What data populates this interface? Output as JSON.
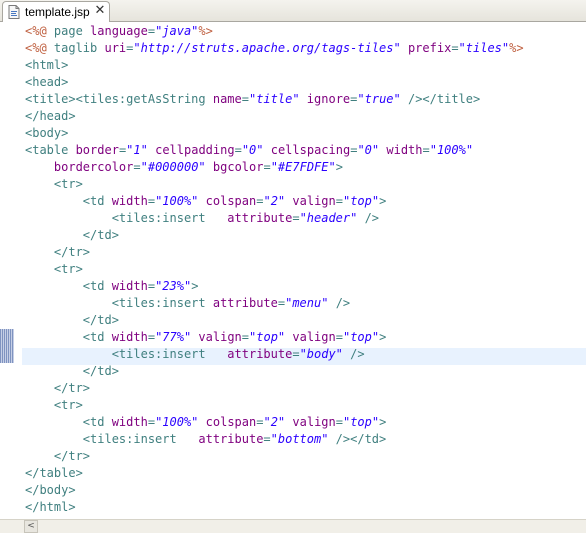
{
  "tab": {
    "label": "template.jsp",
    "close_glyph": "✕",
    "icon": "jsp-file-icon"
  },
  "colors": {
    "directive": "#bf5f3f",
    "tag": "#3f7f7f",
    "attribute": "#7f007f",
    "value": "#2a00ff",
    "current_line": "#e8f2fe"
  },
  "code_lines": [
    [
      [
        "dir",
        "<%@ "
      ],
      [
        "tag",
        "page "
      ],
      [
        "attr",
        "language"
      ],
      [
        "tag",
        "="
      ],
      [
        "val",
        "\"java\""
      ],
      [
        "dir",
        "%>"
      ]
    ],
    [
      [
        "dir",
        "<%@ "
      ],
      [
        "tag",
        "taglib "
      ],
      [
        "attr",
        "uri"
      ],
      [
        "tag",
        "="
      ],
      [
        "val",
        "\"http://struts.apache.org/tags-tiles\""
      ],
      [
        "tag",
        " "
      ],
      [
        "attr",
        "prefix"
      ],
      [
        "tag",
        "="
      ],
      [
        "val",
        "\"tiles\""
      ],
      [
        "dir",
        "%>"
      ]
    ],
    [
      [
        "tag",
        "<html>"
      ]
    ],
    [
      [
        "tag",
        "<head>"
      ]
    ],
    [
      [
        "tag",
        "<title><tiles:getAsString "
      ],
      [
        "attr",
        "name"
      ],
      [
        "tag",
        "="
      ],
      [
        "val",
        "\"title\""
      ],
      [
        "tag",
        " "
      ],
      [
        "attr",
        "ignore"
      ],
      [
        "tag",
        "="
      ],
      [
        "val",
        "\"true\""
      ],
      [
        "tag",
        " /></title>"
      ]
    ],
    [
      [
        "tag",
        "</head>"
      ]
    ],
    [
      [
        "tag",
        "<body>"
      ]
    ],
    [
      [
        "tag",
        "<table "
      ],
      [
        "attr",
        "border"
      ],
      [
        "tag",
        "="
      ],
      [
        "val",
        "\"1\""
      ],
      [
        "tag",
        " "
      ],
      [
        "attr",
        "cellpadding"
      ],
      [
        "tag",
        "="
      ],
      [
        "val",
        "\"0\""
      ],
      [
        "tag",
        " "
      ],
      [
        "attr",
        "cellspacing"
      ],
      [
        "tag",
        "="
      ],
      [
        "val",
        "\"0\""
      ],
      [
        "tag",
        " "
      ],
      [
        "attr",
        "width"
      ],
      [
        "tag",
        "="
      ],
      [
        "val",
        "\"100%\""
      ]
    ],
    [
      [
        "tag",
        "    "
      ],
      [
        "attr",
        "bordercolor"
      ],
      [
        "tag",
        "="
      ],
      [
        "val",
        "\"#000000\""
      ],
      [
        "tag",
        " "
      ],
      [
        "attr",
        "bgcolor"
      ],
      [
        "tag",
        "="
      ],
      [
        "val",
        "\"#E7FDFE\""
      ],
      [
        "tag",
        ">"
      ]
    ],
    [
      [
        "tag",
        "    <tr>"
      ]
    ],
    [
      [
        "tag",
        "        <td "
      ],
      [
        "attr",
        "width"
      ],
      [
        "tag",
        "="
      ],
      [
        "val",
        "\"100%\""
      ],
      [
        "tag",
        " "
      ],
      [
        "attr",
        "colspan"
      ],
      [
        "tag",
        "="
      ],
      [
        "val",
        "\"2\""
      ],
      [
        "tag",
        " "
      ],
      [
        "attr",
        "valign"
      ],
      [
        "tag",
        "="
      ],
      [
        "val",
        "\"top\""
      ],
      [
        "tag",
        ">"
      ]
    ],
    [
      [
        "tag",
        "            <tiles:insert   "
      ],
      [
        "attr",
        "attribute"
      ],
      [
        "tag",
        "="
      ],
      [
        "val",
        "\"header\""
      ],
      [
        "tag",
        " />"
      ]
    ],
    [
      [
        "tag",
        "        </td>"
      ]
    ],
    [
      [
        "tag",
        "    </tr>"
      ]
    ],
    [
      [
        "tag",
        "    <tr>"
      ]
    ],
    [
      [
        "tag",
        "        <td "
      ],
      [
        "attr",
        "width"
      ],
      [
        "tag",
        "="
      ],
      [
        "val",
        "\"23%\""
      ],
      [
        "tag",
        ">"
      ]
    ],
    [
      [
        "tag",
        "            <tiles:insert "
      ],
      [
        "attr",
        "attribute"
      ],
      [
        "tag",
        "="
      ],
      [
        "val",
        "\"menu\""
      ],
      [
        "tag",
        " />"
      ]
    ],
    [
      [
        "tag",
        "        </td>"
      ]
    ],
    [
      [
        "tag",
        "        <td "
      ],
      [
        "attr",
        "width"
      ],
      [
        "tag",
        "="
      ],
      [
        "val",
        "\"77%\""
      ],
      [
        "tag",
        " "
      ],
      [
        "attr",
        "valign"
      ],
      [
        "tag",
        "="
      ],
      [
        "val",
        "\"top\""
      ],
      [
        "tag",
        " "
      ],
      [
        "attr",
        "valign"
      ],
      [
        "tag",
        "="
      ],
      [
        "val",
        "\"top\""
      ],
      [
        "tag",
        ">"
      ]
    ],
    [
      [
        "tag",
        "            <tiles:insert   "
      ],
      [
        "attr",
        "attribute"
      ],
      [
        "tag",
        "="
      ],
      [
        "val",
        "\"body\""
      ],
      [
        "tag",
        " />"
      ]
    ],
    [
      [
        "tag",
        "        </td>"
      ]
    ],
    [
      [
        "tag",
        "    </tr>"
      ]
    ],
    [
      [
        "tag",
        "    <tr>"
      ]
    ],
    [
      [
        "tag",
        "        <td "
      ],
      [
        "attr",
        "width"
      ],
      [
        "tag",
        "="
      ],
      [
        "val",
        "\"100%\""
      ],
      [
        "tag",
        " "
      ],
      [
        "attr",
        "colspan"
      ],
      [
        "tag",
        "="
      ],
      [
        "val",
        "\"2\""
      ],
      [
        "tag",
        " "
      ],
      [
        "attr",
        "valign"
      ],
      [
        "tag",
        "="
      ],
      [
        "val",
        "\"top\""
      ],
      [
        "tag",
        ">"
      ]
    ],
    [
      [
        "tag",
        "        <tiles:insert   "
      ],
      [
        "attr",
        "attribute"
      ],
      [
        "tag",
        "="
      ],
      [
        "val",
        "\"bottom\""
      ],
      [
        "tag",
        " /></td>"
      ]
    ],
    [
      [
        "tag",
        "    </tr>"
      ]
    ],
    [
      [
        "tag",
        "</table>"
      ]
    ],
    [
      [
        "tag",
        "</body>"
      ]
    ],
    [
      [
        "tag",
        "</html>"
      ]
    ]
  ],
  "scrollbar": {
    "left_arrow": "<"
  }
}
